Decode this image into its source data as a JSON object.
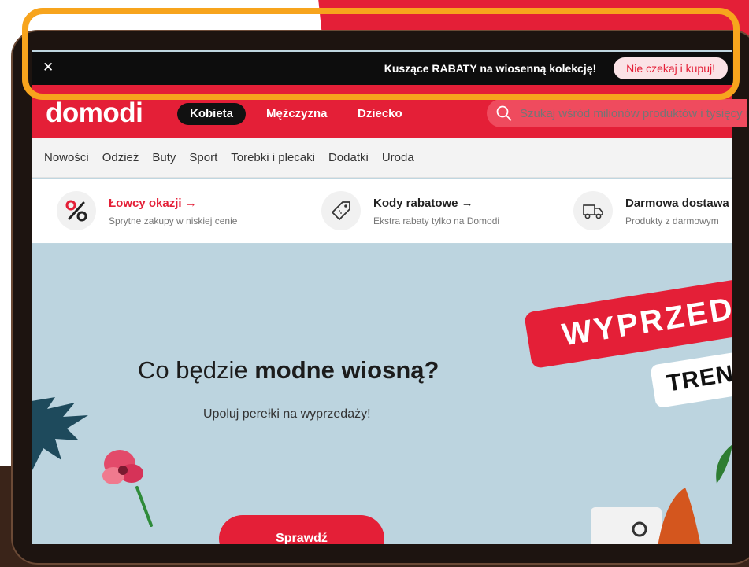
{
  "promo": {
    "close_glyph": "✕",
    "text": "Kuszące RABATY na wiosenną kolekcję!",
    "cta_label": "Nie czekaj i kupuj!"
  },
  "header": {
    "logo": "domodi",
    "nav": [
      "Kobieta",
      "Mężczyzna",
      "Dziecko"
    ],
    "active_nav": "Kobieta",
    "search_placeholder": "Szukaj wśród milionów produktów i tysięcy marek"
  },
  "categories": [
    "Nowości",
    "Odzież",
    "Buty",
    "Sport",
    "Torebki i plecaki",
    "Dodatki",
    "Uroda"
  ],
  "features": [
    {
      "title": "Łowcy okazji →",
      "subtitle": "Sprytne zakupy w niskiej cenie",
      "icon": "percent-icon"
    },
    {
      "title": "Kody rabatowe →",
      "subtitle": "Ekstra rabaty tylko na Domodi",
      "icon": "tag-icon"
    },
    {
      "title": "Darmowa dostawa",
      "subtitle": "Produkty z darmowym",
      "icon": "truck-icon"
    }
  ],
  "hero": {
    "heading_regular": "Co będzie ",
    "heading_bold": "modne wiosną?",
    "subheading": "Upoluj perełki na wyprzedaży!",
    "cta_label": "Sprawdź",
    "sale_label": "WYPRZED",
    "trend_label": "TREN"
  },
  "colors": {
    "brand_red": "#e41f37",
    "promo_bg": "#0d0d0d",
    "highlight": "#f7a41d",
    "hero_bg": "#bcd4df"
  }
}
